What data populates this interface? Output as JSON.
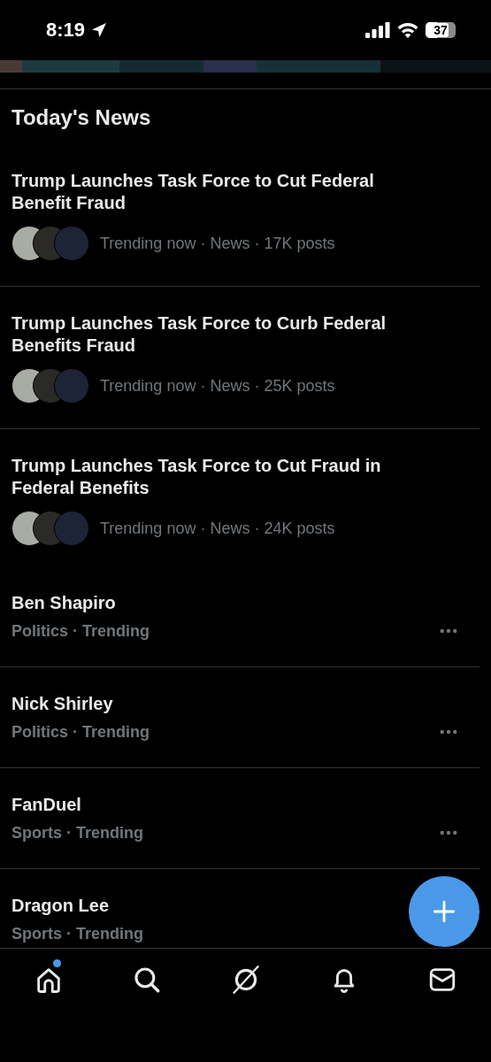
{
  "status_bar": {
    "time": "8:19",
    "battery": "37"
  },
  "section_title": "Today's News",
  "news": [
    {
      "title": "Trump Launches Task Force to Cut Federal Benefit Fraud",
      "meta": "Trending now · News · 17K posts"
    },
    {
      "title": "Trump Launches Task Force to Curb Federal Benefits Fraud",
      "meta": "Trending now · News · 25K posts"
    },
    {
      "title": "Trump Launches Task Force to Cut Fraud in Federal Benefits",
      "meta": "Trending now · News · 24K posts"
    }
  ],
  "trends": [
    {
      "name": "Ben Shapiro",
      "context": "Politics · Trending"
    },
    {
      "name": "Nick Shirley",
      "context": "Politics · Trending"
    },
    {
      "name": "FanDuel",
      "context": "Sports · Trending"
    },
    {
      "name": "Dragon Lee",
      "context": "Sports · Trending"
    }
  ],
  "nav": [
    {
      "kind": "home",
      "dot": true
    },
    {
      "kind": "search",
      "dot": false
    },
    {
      "kind": "grok",
      "dot": false
    },
    {
      "kind": "notifications",
      "dot": false
    },
    {
      "kind": "messages",
      "dot": false
    }
  ]
}
